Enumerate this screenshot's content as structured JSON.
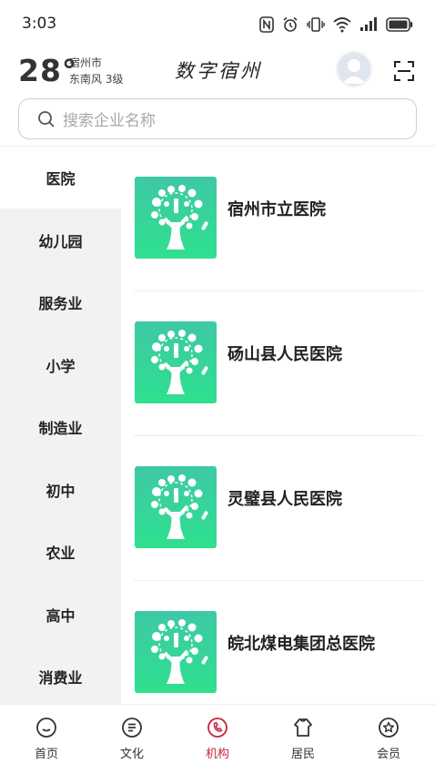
{
  "status_bar": {
    "time": "3:03"
  },
  "header": {
    "temperature": "28°",
    "city": "宿州市",
    "wind": "东南风  3级",
    "app_title": "数字宿州"
  },
  "search": {
    "placeholder": "搜索企业名称"
  },
  "sidebar": {
    "active_index": 0,
    "items": [
      "医院",
      "幼儿园",
      "服务业",
      "小学",
      "制造业",
      "初中",
      "农业",
      "高中",
      "消费业"
    ]
  },
  "list": {
    "items": [
      {
        "name": "宿州市立医院"
      },
      {
        "name": "砀山县人民医院"
      },
      {
        "name": "灵璧县人民医院"
      },
      {
        "name": "皖北煤电集团总医院"
      }
    ]
  },
  "bottom_nav": {
    "active_index": 2,
    "items": [
      {
        "label": "首页",
        "icon": "home-icon"
      },
      {
        "label": "文化",
        "icon": "culture-icon"
      },
      {
        "label": "机构",
        "icon": "organization-icon"
      },
      {
        "label": "居民",
        "icon": "residents-icon"
      },
      {
        "label": "会员",
        "icon": "member-icon"
      }
    ]
  },
  "colors": {
    "accent": "#c7243a",
    "thumb_gradient_top": "#3ec8a6",
    "thumb_gradient_bottom": "#2fe08e",
    "sidebar_bg": "#f2f2f2"
  }
}
